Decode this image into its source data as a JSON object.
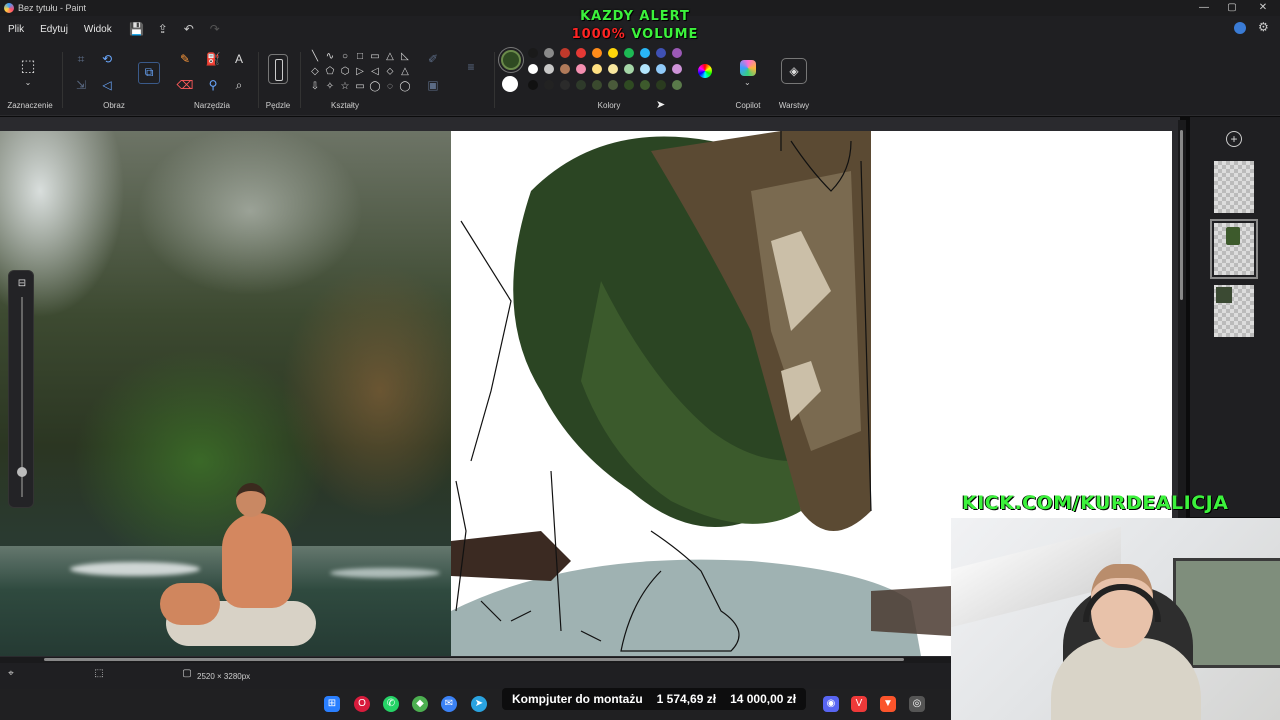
{
  "window": {
    "title": "Bez tytułu - Paint",
    "controls": {
      "minimize": "—",
      "maximize": "▢",
      "close": "✕"
    }
  },
  "menu": {
    "items": [
      "Plik",
      "Edytuj",
      "Widok"
    ],
    "icons": [
      "save-icon",
      "share-icon",
      "undo-icon",
      "redo-icon"
    ]
  },
  "overlay": {
    "line1": "KAZDY ALERT",
    "line2_red": "1000%",
    "line2_green": " VOLUME",
    "kick": "KICK.COM/KURDEALICJA"
  },
  "ribbon": {
    "groups": {
      "selection": "Zaznaczenie",
      "image": "Obraz",
      "tools": "Narzędzia",
      "brushes": "Pędzle",
      "shapes": "Kształty",
      "colors": "Kolory",
      "copilot": "Copilot",
      "layers": "Warstwy"
    },
    "shapes": [
      "╲",
      "∿",
      "○",
      "□",
      "▭",
      "△",
      "◺",
      "◇",
      "⬠",
      "⬡",
      "▷",
      "◁",
      "⬦",
      "△",
      "⇩",
      "✧",
      "☆",
      "▭",
      "◯",
      "◌",
      "◯"
    ],
    "palette": [
      "#1a1a1a",
      "#8a8a8a",
      "#c0392b",
      "#e53935",
      "#ff8c1a",
      "#ffd60a",
      "#1db954",
      "#29b6f6",
      "#3f51b5",
      "#9b59b6",
      "#ffffff",
      "#c8c8c8",
      "#b07a5a",
      "#f48fb1",
      "#ffe082",
      "#f9e79f",
      "#a5d6a7",
      "#b3e5fc",
      "#90caf9",
      "#ce93d8",
      "#111111",
      "#222222",
      "#2b2b2b",
      "#2e3a2a",
      "#3a4a2e",
      "#4a5a3a",
      "#2f4a22",
      "#3d5a2c",
      "#2a3b1f",
      "#5a7a4a"
    ],
    "current_primary": "#2f4a22",
    "current_secondary": "#ffffff"
  },
  "status": {
    "dimensions": "2520 × 3280px"
  },
  "ticker": {
    "text": "Kompjuter do montażu",
    "amount": "1 574,69 zł",
    "goal": "14 000,00 zł"
  },
  "taskbar": {
    "icons": [
      "windows-icon",
      "opera-icon",
      "whatsapp-icon",
      "app-icon",
      "messenger-icon",
      "telegram-icon"
    ]
  }
}
